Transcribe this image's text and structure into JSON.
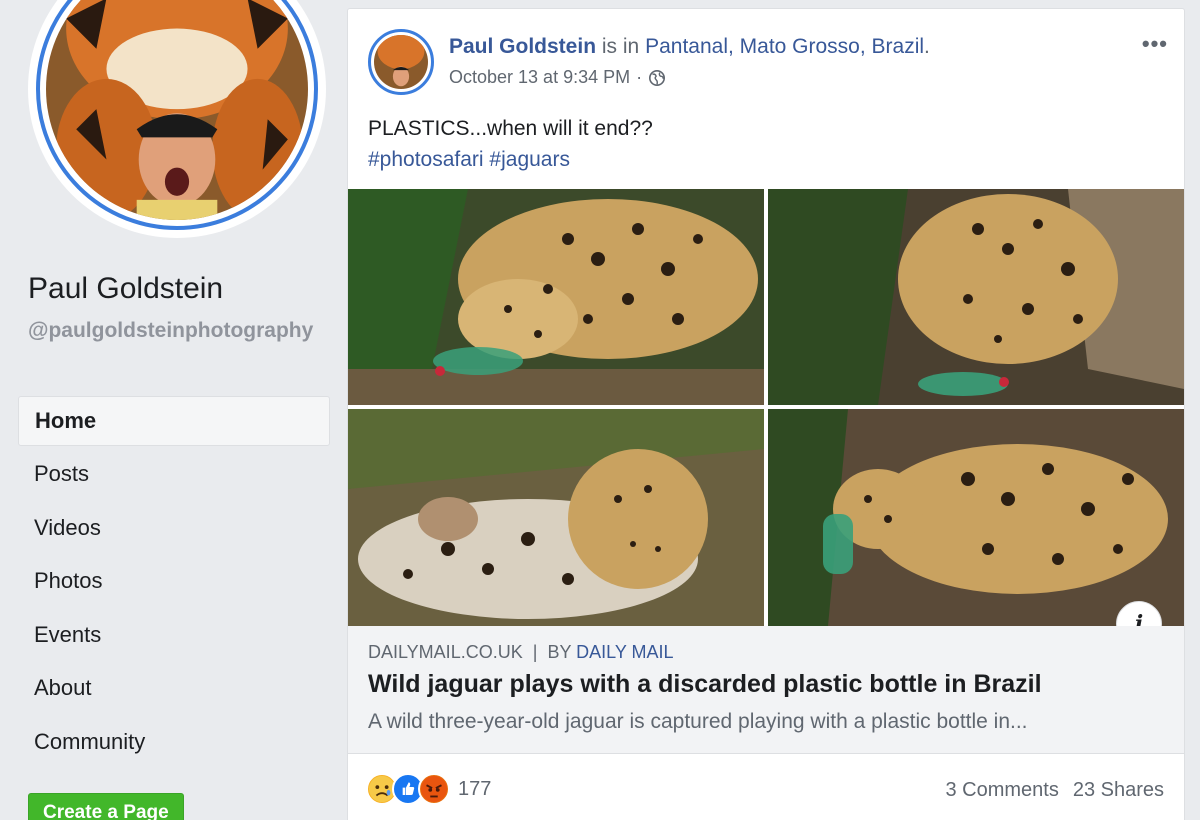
{
  "sidebar": {
    "page_name": "Paul Goldstein",
    "handle": "@paulgoldsteinphotography",
    "nav": [
      {
        "label": "Home",
        "active": true
      },
      {
        "label": "Posts"
      },
      {
        "label": "Videos"
      },
      {
        "label": "Photos"
      },
      {
        "label": "Events"
      },
      {
        "label": "About"
      },
      {
        "label": "Community"
      }
    ],
    "create_button": "Create a Page"
  },
  "post": {
    "author": "Paul Goldstein",
    "is_in": "is in",
    "location": "Pantanal, Mato Grosso, Brazil",
    "location_period": ".",
    "timestamp": "October 13 at 9:34 PM",
    "separator": "·",
    "privacy_icon": "globe-icon",
    "more_icon": "•••",
    "text": "PLASTICS...when will it end??",
    "hashtags": "#photosafari #jaguars",
    "info_icon": "i",
    "link": {
      "domain": "DAILYMAIL.CO.UK",
      "divider": "|",
      "by_prefix": "BY",
      "by_name": "DAILY MAIL",
      "title": "Wild jaguar plays with a discarded plastic bottle in Brazil",
      "description": "A wild three-year-old jaguar is captured playing with a plastic bottle in..."
    },
    "reactions": {
      "icons": [
        "sad-reaction-icon",
        "like-reaction-icon",
        "angry-reaction-icon"
      ],
      "count": "177"
    },
    "comments": "3 Comments",
    "shares": "23 Shares"
  },
  "colors": {
    "brand_link": "#385898",
    "ring": "#3b7ddd",
    "create_green": "#42b72a",
    "background": "#e9ebee"
  }
}
